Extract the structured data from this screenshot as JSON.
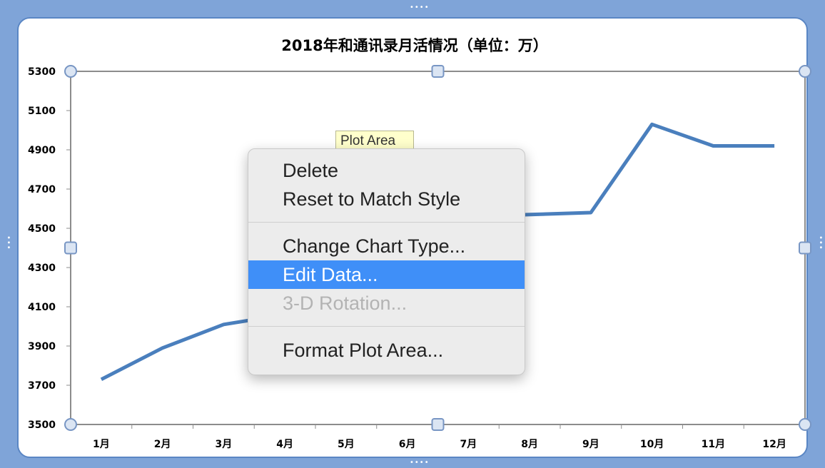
{
  "chart_data": {
    "type": "line",
    "title": "2018年和通讯录月活情况（单位：万）",
    "categories": [
      "1月",
      "2月",
      "3月",
      "4月",
      "5月",
      "6月",
      "7月",
      "8月",
      "9月",
      "10月",
      "11月",
      "12月"
    ],
    "series": [
      {
        "values": [
          3730,
          3890,
          4010,
          4060,
          4150,
          4320,
          4560,
          4570,
          4580,
          5030,
          4920,
          4920
        ]
      }
    ],
    "yticks": [
      "5300",
      "5100",
      "4900",
      "4700",
      "4500",
      "4300",
      "4100",
      "3900",
      "3700",
      "3500"
    ],
    "ylim": [
      3500,
      5300
    ],
    "grid": false,
    "legend": "none",
    "line_color": "#4a7fbd"
  },
  "tooltip": {
    "text": "Plot Area"
  },
  "context_menu": {
    "items": [
      {
        "label": "Delete",
        "state": "normal"
      },
      {
        "label": "Reset to Match Style",
        "state": "normal"
      },
      {
        "label": "Change Chart Type...",
        "state": "normal"
      },
      {
        "label": "Edit Data...",
        "state": "highlighted"
      },
      {
        "label": "3-D Rotation...",
        "state": "disabled"
      },
      {
        "label": "Format Plot Area...",
        "state": "normal"
      }
    ],
    "highlight_color": "#3f8ff8"
  }
}
